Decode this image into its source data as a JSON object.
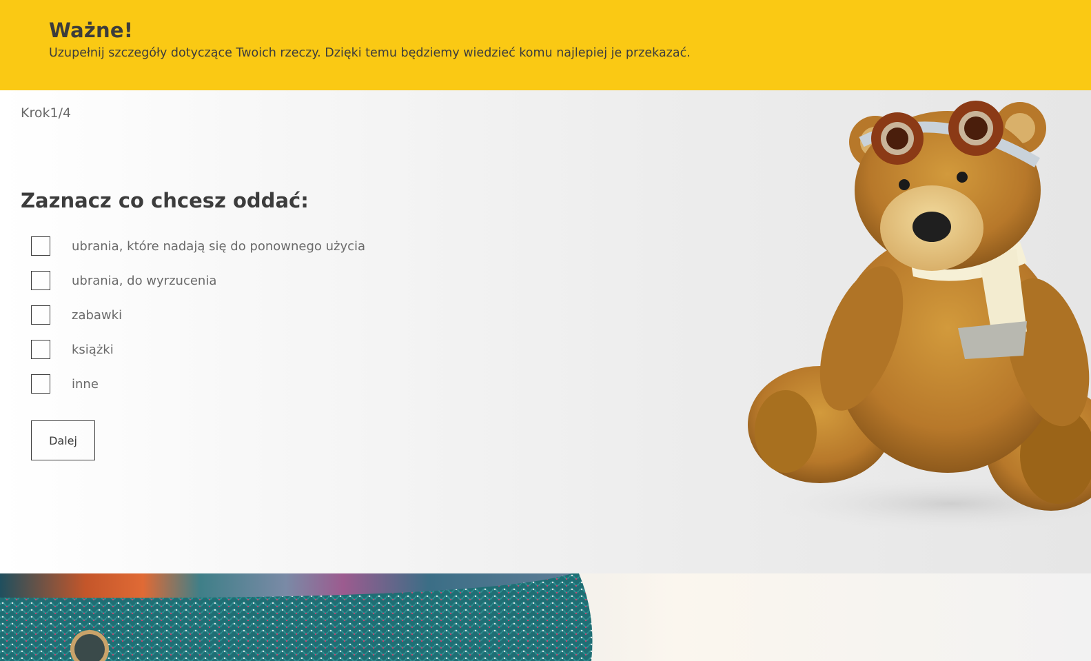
{
  "banner": {
    "title": "Ważne!",
    "text": "Uzupełnij szczegóły dotyczące Twoich rzeczy. Dzięki temu będziemy wiedzieć komu najlepiej je przekazać."
  },
  "form": {
    "step": "Krok1/4",
    "question": "Zaznacz co chcesz oddać:",
    "options": [
      {
        "label": "ubrania, które nadają się do ponownego użycia",
        "checked": false
      },
      {
        "label": "ubrania, do wyrzucenia",
        "checked": false
      },
      {
        "label": "zabawki",
        "checked": false
      },
      {
        "label": "książki",
        "checked": false
      },
      {
        "label": "inne",
        "checked": false
      }
    ],
    "next_label": "Dalej"
  },
  "colors": {
    "banner_bg": "#fac914",
    "text_dark": "#3c3c3c",
    "text_muted": "#6a6a6a"
  },
  "images": {
    "hero": "teddy-bear-with-goggles-and-scarf",
    "bottom": "knitted-sweater"
  }
}
